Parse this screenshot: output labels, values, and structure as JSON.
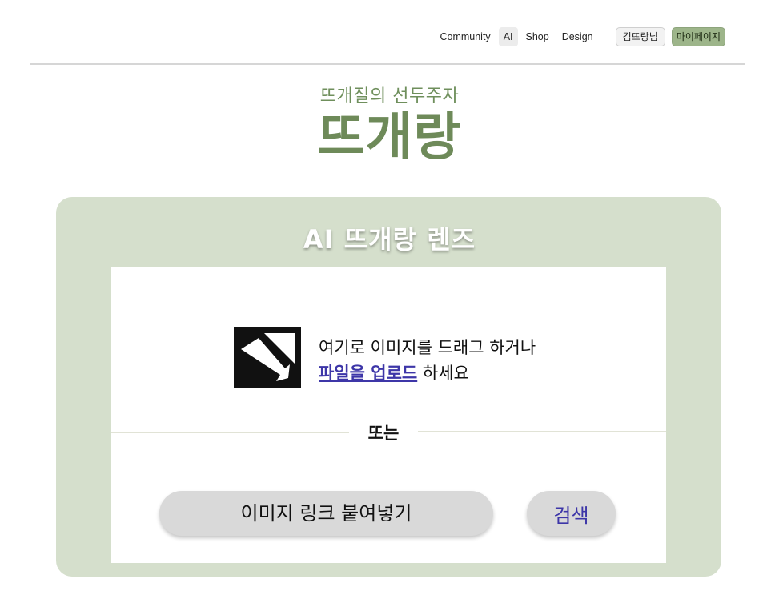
{
  "nav": {
    "links": [
      "Community",
      "AI",
      "Shop",
      "Design"
    ],
    "active": "AI",
    "user_label": "김뜨랑님",
    "mypage_label": "마이페이지"
  },
  "hero": {
    "tagline": "뜨개질의 선두주자",
    "brand": "뜨개랑"
  },
  "lens": {
    "title": "AI 뜨개랑 렌즈",
    "drop_text_line1": "여기로 이미지를 드래그 하거나",
    "upload_link": "파일을 업로드",
    "drop_text_suffix": " 하세요",
    "or_text": "또는",
    "link_placeholder": "이미지 링크 붙여넣기",
    "search_label": "검색"
  },
  "colors": {
    "accent_green": "#6e8a59",
    "panel_bg": "#d5dfcc",
    "link_purple": "#3d36a8",
    "mypage_bg": "#9db58a"
  },
  "icons": {
    "upload": "image-upload-icon"
  }
}
